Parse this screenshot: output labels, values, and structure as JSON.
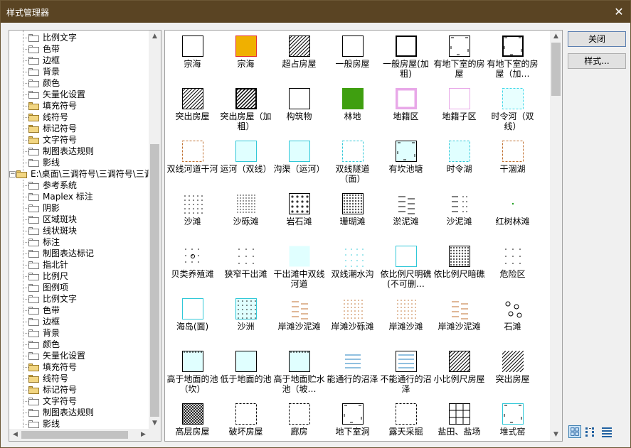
{
  "window": {
    "title": "样式管理器",
    "close_glyph": "✕"
  },
  "buttons": {
    "close_label": "关闭",
    "style_label": "样式..."
  },
  "tree": {
    "items": [
      {
        "label": "比例文字",
        "level": 2,
        "open": false
      },
      {
        "label": "色带",
        "level": 2,
        "open": false
      },
      {
        "label": "边框",
        "level": 2,
        "open": false
      },
      {
        "label": "背景",
        "level": 2,
        "open": false
      },
      {
        "label": "颜色",
        "level": 2,
        "open": false
      },
      {
        "label": "矢量化设置",
        "level": 2,
        "open": false
      },
      {
        "label": "填充符号",
        "level": 2,
        "open": true
      },
      {
        "label": "线符号",
        "level": 2,
        "open": true
      },
      {
        "label": "标记符号",
        "level": 2,
        "open": true
      },
      {
        "label": "文字符号",
        "level": 2,
        "open": true
      },
      {
        "label": "制图表达规则",
        "level": 2,
        "open": false
      },
      {
        "label": "影线",
        "level": 2,
        "open": false
      },
      {
        "label": "E:\\桌面\\三调符号\\三调符号\\三调",
        "level": 1,
        "open": true,
        "expander": "−"
      },
      {
        "label": "参考系统",
        "level": 2,
        "open": false
      },
      {
        "label": "Maplex 标注",
        "level": 2,
        "open": false
      },
      {
        "label": "阴影",
        "level": 2,
        "open": false
      },
      {
        "label": "区域斑块",
        "level": 2,
        "open": false
      },
      {
        "label": "线状斑块",
        "level": 2,
        "open": false
      },
      {
        "label": "标注",
        "level": 2,
        "open": false
      },
      {
        "label": "制图表达标记",
        "level": 2,
        "open": false
      },
      {
        "label": "指北针",
        "level": 2,
        "open": false
      },
      {
        "label": "比例尺",
        "level": 2,
        "open": false
      },
      {
        "label": "图例项",
        "level": 2,
        "open": false
      },
      {
        "label": "比例文字",
        "level": 2,
        "open": false
      },
      {
        "label": "色带",
        "level": 2,
        "open": false
      },
      {
        "label": "边框",
        "level": 2,
        "open": false
      },
      {
        "label": "背景",
        "level": 2,
        "open": false
      },
      {
        "label": "颜色",
        "level": 2,
        "open": false
      },
      {
        "label": "矢量化设置",
        "level": 2,
        "open": false
      },
      {
        "label": "填充符号",
        "level": 2,
        "open": true,
        "selected_open": true
      },
      {
        "label": "线符号",
        "level": 2,
        "open": true
      },
      {
        "label": "标记符号",
        "level": 2,
        "open": true
      },
      {
        "label": "文字符号",
        "level": 2,
        "open": false
      },
      {
        "label": "制图表达规则",
        "level": 2,
        "open": false
      },
      {
        "label": "影线",
        "level": 2,
        "open": false
      }
    ]
  },
  "symbols": [
    {
      "label": "宗海",
      "fill": "#ffffff",
      "stroke": "#000000",
      "pattern": "none"
    },
    {
      "label": "宗海",
      "fill": "#f0b000",
      "stroke": "#e03030",
      "pattern": "none"
    },
    {
      "label": "超占房屋",
      "fill": "#ffffff",
      "stroke": "#000000",
      "pattern": "hatch"
    },
    {
      "label": "一般房屋",
      "fill": "#ffffff",
      "stroke": "#000000",
      "pattern": "none"
    },
    {
      "label": "一般房屋(加粗)",
      "fill": "#ffffff",
      "stroke": "#000000",
      "pattern": "thick"
    },
    {
      "label": "有地下室的房屋",
      "fill": "#ffffff",
      "stroke": "#000000",
      "pattern": "corners"
    },
    {
      "label": "有地下室的房屋（加…",
      "fill": "#ffffff",
      "stroke": "#000000",
      "pattern": "thickcorners"
    },
    {
      "label": "突出房屋",
      "fill": "#ffffff",
      "stroke": "#000000",
      "pattern": "hatch"
    },
    {
      "label": "突出房屋（加粗）",
      "fill": "#ffffff",
      "stroke": "#000000",
      "pattern": "thickhatch"
    },
    {
      "label": "构筑物",
      "fill": "#ffffff",
      "stroke": "#000000",
      "pattern": "none"
    },
    {
      "label": "林地",
      "fill": "#3f9f10",
      "stroke": "#3f9f10",
      "pattern": "none"
    },
    {
      "label": "地籍区",
      "fill": "#ffffff",
      "stroke": "#e8a8e8",
      "pattern": "thickpink"
    },
    {
      "label": "地籍子区",
      "fill": "#ffffff",
      "stroke": "#e8a8e8",
      "pattern": "none"
    },
    {
      "label": "时令河（双线）",
      "fill": "#e8ffff",
      "stroke": "#40d8e8",
      "pattern": "dashed"
    },
    {
      "label": "双线河道干河",
      "fill": "#ffffff",
      "stroke": "#c07030",
      "pattern": "dashed"
    },
    {
      "label": "运河（双线）",
      "fill": "#e0ffff",
      "stroke": "#30c8d8",
      "pattern": "none"
    },
    {
      "label": "沟渠（运河）",
      "fill": "#e0ffff",
      "stroke": "#30c8d8",
      "pattern": "none"
    },
    {
      "label": "双线隧道（面）",
      "fill": "#ffffff",
      "stroke": "#30c8d8",
      "pattern": "dashed"
    },
    {
      "label": "有坎池塘",
      "fill": "#e0ffff",
      "stroke": "#000000",
      "pattern": "corners"
    },
    {
      "label": "时令湖",
      "fill": "#e0ffff",
      "stroke": "#30c8d8",
      "pattern": "dashed"
    },
    {
      "label": "干涸湖",
      "fill": "#ffffff",
      "stroke": "#c07030",
      "pattern": "dashed"
    },
    {
      "label": "沙滩",
      "fill": "#ffffff",
      "stroke": "none",
      "pattern": "dots"
    },
    {
      "label": "沙砾滩",
      "fill": "#ffffff",
      "stroke": "none",
      "pattern": "densedots"
    },
    {
      "label": "岩石滩",
      "fill": "#ffffff",
      "stroke": "#000000",
      "pattern": "rocks"
    },
    {
      "label": "珊瑚滩",
      "fill": "#ffffff",
      "stroke": "#000000",
      "pattern": "coral"
    },
    {
      "label": "淤泥滩",
      "fill": "#ffffff",
      "stroke": "none",
      "pattern": "dashes"
    },
    {
      "label": "沙泥滩",
      "fill": "#ffffff",
      "stroke": "none",
      "pattern": "dashdots"
    },
    {
      "label": "红树林滩",
      "fill": "#ffffff",
      "stroke": "none",
      "pattern": "greendot"
    },
    {
      "label": "贝类养殖滩",
      "fill": "#ffffff",
      "stroke": "none",
      "pattern": "shells"
    },
    {
      "label": "狭窄干出滩",
      "fill": "#ffffff",
      "stroke": "none",
      "pattern": "sparsedots"
    },
    {
      "label": "干出滩中双线河道",
      "fill": "#e0ffff",
      "stroke": "none",
      "pattern": "none"
    },
    {
      "label": "双线潮水沟",
      "fill": "#ffffff",
      "stroke": "none",
      "pattern": "cyandots"
    },
    {
      "label": "依比例尺明礁(不可删…",
      "fill": "#ffffff",
      "stroke": "#30c8d8",
      "pattern": "none"
    },
    {
      "label": "依比例尺暗礁",
      "fill": "#ffffff",
      "stroke": "#000000",
      "pattern": "coral"
    },
    {
      "label": "危险区",
      "fill": "#ffffff",
      "stroke": "none",
      "pattern": "sparsedots"
    },
    {
      "label": "海岛(面)",
      "fill": "#ffffff",
      "stroke": "#30c8d8",
      "pattern": "none"
    },
    {
      "label": "沙洲",
      "fill": "#e0ffff",
      "stroke": "#30c8d8",
      "pattern": "dots"
    },
    {
      "label": "岸滩沙泥滩",
      "fill": "#ffffff",
      "stroke": "none",
      "pattern": "browndashes"
    },
    {
      "label": "岸滩沙砾滩",
      "fill": "#ffffff",
      "stroke": "none",
      "pattern": "browndots"
    },
    {
      "label": "岸滩沙滩",
      "fill": "#ffffff",
      "stroke": "none",
      "pattern": "browndots"
    },
    {
      "label": "岸滩沙泥滩",
      "fill": "#ffffff",
      "stroke": "none",
      "pattern": "browndashes"
    },
    {
      "label": "石滩",
      "fill": "#ffffff",
      "stroke": "none",
      "pattern": "stones"
    },
    {
      "label": "高于地面的池（坎）",
      "fill": "#e0ffff",
      "stroke": "#000000",
      "pattern": "ticks"
    },
    {
      "label": "低于地面的池",
      "fill": "#e0ffff",
      "stroke": "#000000",
      "pattern": "none"
    },
    {
      "label": "高于地面贮水池（坡…",
      "fill": "#e0ffff",
      "stroke": "#000000",
      "pattern": "ticks"
    },
    {
      "label": "能通行的沼泽",
      "fill": "#ffffff",
      "stroke": "none",
      "pattern": "marsh"
    },
    {
      "label": "不能通行的沼泽",
      "fill": "#ffffff",
      "stroke": "#000000",
      "pattern": "marsh"
    },
    {
      "label": "小比例尺房屋",
      "fill": "#ffffff",
      "stroke": "#000000",
      "pattern": "hatch"
    },
    {
      "label": "突出房屋",
      "fill": "#ffffff",
      "stroke": "none",
      "pattern": "hatch"
    },
    {
      "label": "高层房屋",
      "fill": "#ffffff",
      "stroke": "#000000",
      "pattern": "crosshatch"
    },
    {
      "label": "破坏房屋",
      "fill": "#ffffff",
      "stroke": "#000000",
      "pattern": "dashed"
    },
    {
      "label": "廊房",
      "fill": "#ffffff",
      "stroke": "#000000",
      "pattern": "dashed"
    },
    {
      "label": "地下室洞",
      "fill": "#ffffff",
      "stroke": "#000000",
      "pattern": "corners"
    },
    {
      "label": "露天采掘",
      "fill": "#ffffff",
      "stroke": "#000000",
      "pattern": "dashed"
    },
    {
      "label": "盐田、盐场",
      "fill": "#ffffff",
      "stroke": "#000000",
      "pattern": "saltgrid"
    },
    {
      "label": "堆式窑",
      "fill": "#ffffff",
      "stroke": "#30c8d8",
      "pattern": "corners"
    }
  ],
  "view_modes": {
    "large_icon": "large-icons-view-icon",
    "list": "list-view-icon",
    "details": "details-view-icon"
  }
}
